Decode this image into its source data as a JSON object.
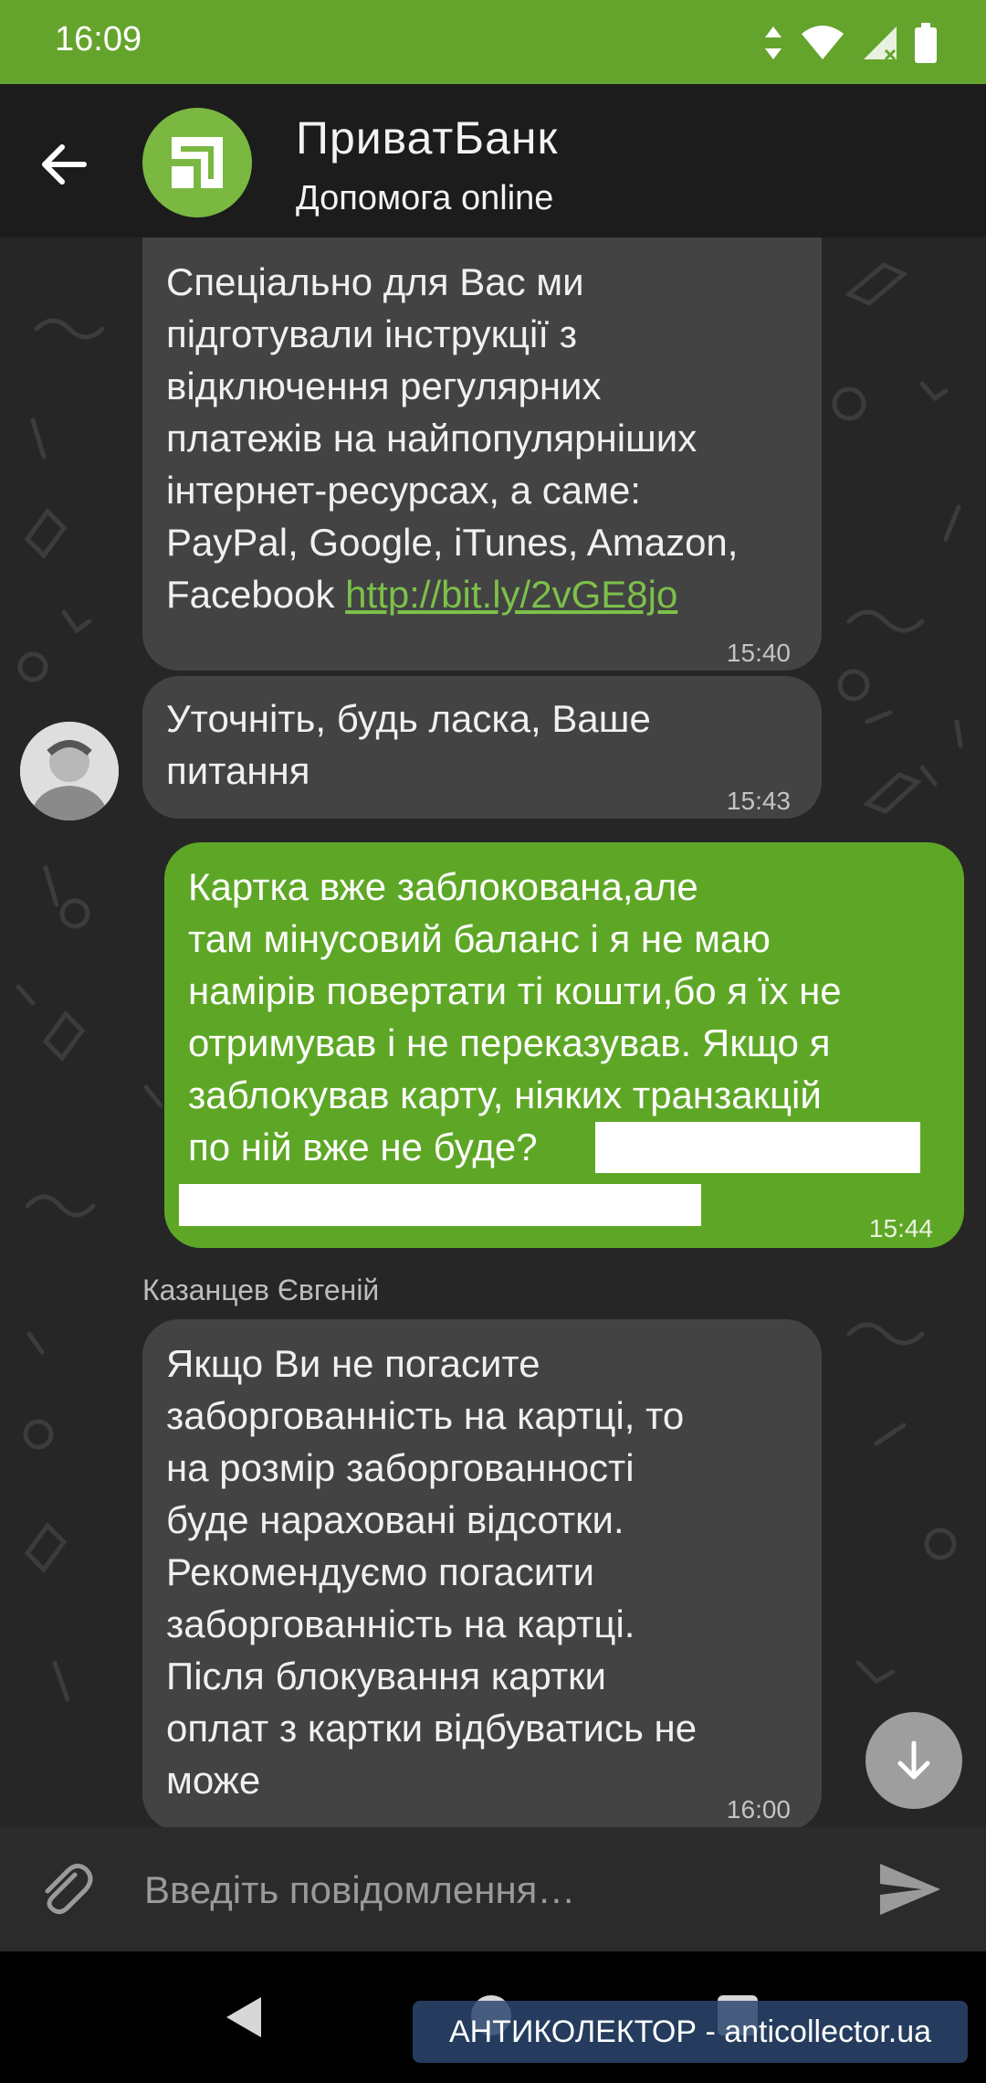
{
  "status_bar": {
    "time": "16:09",
    "icons": [
      "data-arrows-icon",
      "wifi-icon",
      "signal-icon",
      "battery-icon"
    ]
  },
  "app_bar": {
    "title": "ПриватБанк",
    "subtitle": "Допомога online",
    "back_icon": "arrow-left-icon",
    "avatar_icon": "privatbank-logo-icon"
  },
  "messages": [
    {
      "direction": "incoming",
      "text": "Спеціально для Вас ми\nпідготували інструкції з\nвідключення регулярних\nплатежів на найпопулярніших\nінтернет-ресурсах, а саме:\nPayPal, Google, iTunes, Amazon,\nFacebook ",
      "link": "http://bit.ly/2vGE8jo",
      "time": "15:40"
    },
    {
      "direction": "incoming",
      "text": "Уточніть, будь ласка, Ваше\nпитання",
      "time": "15:43"
    },
    {
      "direction": "outgoing",
      "text": "Картка вже заблокована,але\nтам мінусовий баланс і я не маю\nнамірів повертати ті кошти,бо я їх не\nотримував і не переказував. Якщо я\nзаблокував карту, ніяких транзакцій\nпо ній вже не буде?",
      "time": "15:44"
    },
    {
      "direction": "incoming",
      "sender": "Казанцев Євгеній",
      "text": "Якщо Ви не погасите\nзаборгованність на картці, то\nна розмір заборгованності\nбуде нараховані відсотки.\nРекомендуємо погасити\nзаборгованність на картці.\nПісля блокування картки\nоплат з картки відбуватись не\nможе",
      "time": "16:00"
    }
  ],
  "composer": {
    "placeholder": "Введіть повідомлення…",
    "attach_icon": "paperclip-icon",
    "send_icon": "send-icon"
  },
  "scroll_button_icon": "arrow-down-icon",
  "nav_bar": [
    "nav-back-icon",
    "nav-home-icon",
    "nav-recents-icon"
  ],
  "watermark": "АНТИКОЛЕКТОР - anticollector.ua",
  "colors": {
    "status_bar": "#65a42c",
    "outgoing_bubble": "#5ea726",
    "incoming_bubble": "#434343",
    "link": "#7cc04a"
  }
}
